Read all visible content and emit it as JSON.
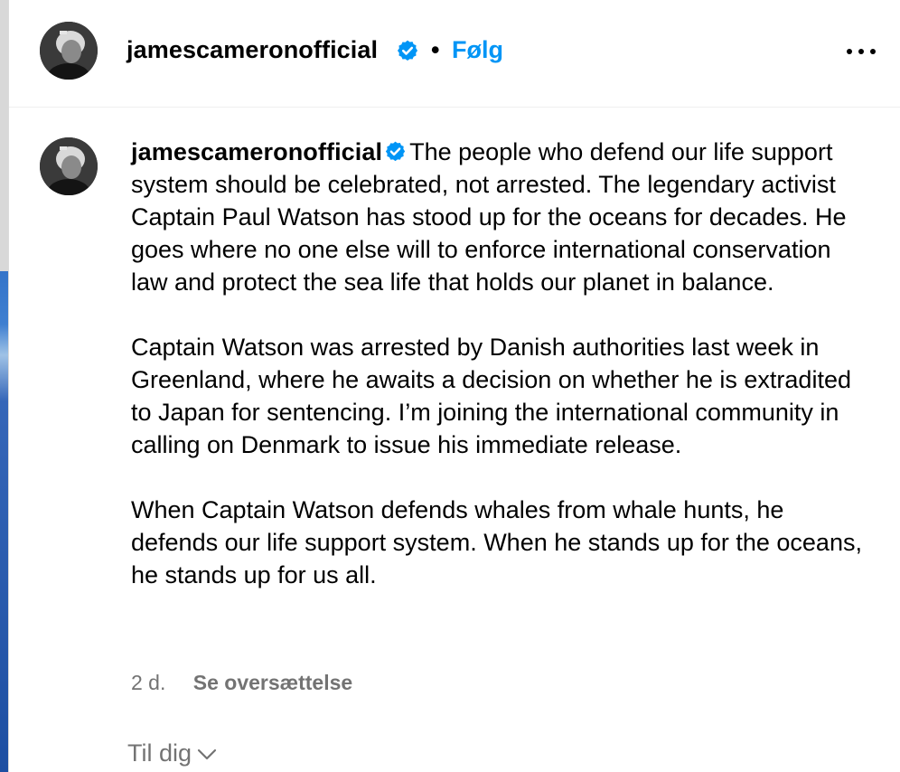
{
  "header": {
    "username": "jamescameronofficial",
    "separator": "•",
    "follow_label": "Følg"
  },
  "post": {
    "username": "jamescameronofficial",
    "paragraphs": [
      "The people who defend our life support system should be celebrated, not arrested. The legendary activist Captain Paul Watson has stood up for the oceans for decades. He goes where no one else will to enforce international conservation law and protect the sea life that holds our planet in balance.",
      "Captain Watson was arrested by Danish authorities last week in Greenland, where he awaits a decision on whether he is extradited to Japan for sentencing. I’m joining the international community in calling on Denmark to issue his immediate release.",
      "When Captain Watson defends whales from whale hunts, he defends our life support system. When he stands up for the oceans, he stands up for us all."
    ],
    "time": "2 d.",
    "translate_label": "Se oversættelse"
  },
  "footer": {
    "for_you_label": "Til dig"
  },
  "icons": {
    "verified": "verified-badge-icon",
    "more": "more-options-icon",
    "chevron": "chevron-down-icon"
  },
  "colors": {
    "accent": "#0095f6",
    "secondary_text": "#737373",
    "verified": "#0095f6"
  }
}
